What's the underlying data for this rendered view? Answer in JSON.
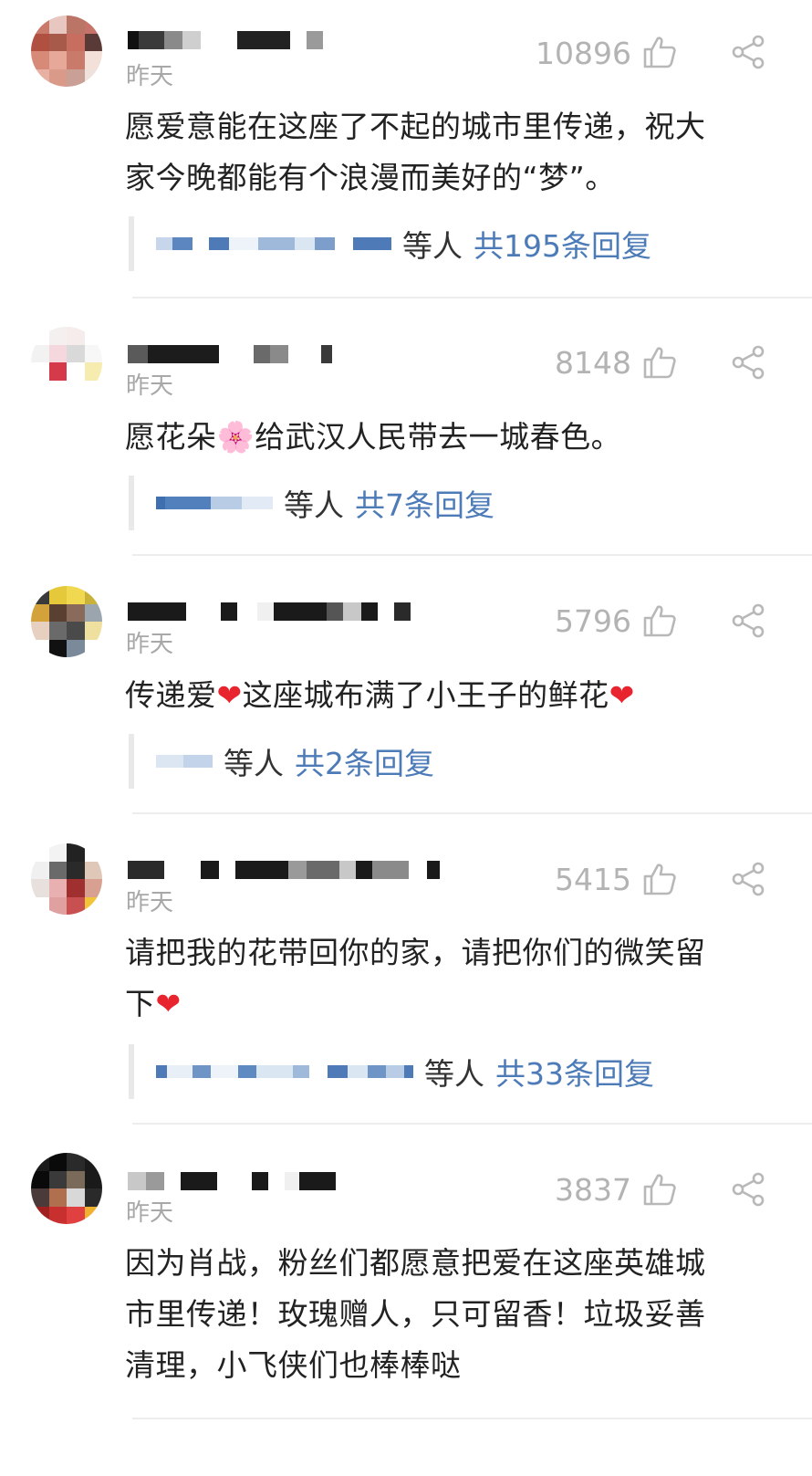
{
  "comments": [
    {
      "time": "昨天",
      "likes": "10896",
      "text_lines": [
        "愿爱意能在这座了不起的城市里传递，祝大",
        "家今晚都能有个浪漫而美好的“梦”。"
      ],
      "replies_etc": "等人",
      "replies_total": "共195条回复"
    },
    {
      "time": "昨天",
      "likes": "8148",
      "text_a": "愿花朵",
      "emoji": "🌸",
      "text_b": "给武汉人民带去一城春色。",
      "replies_etc": "等人",
      "replies_total": "共7条回复"
    },
    {
      "time": "昨天",
      "likes": "5796",
      "text_a": "传递爱",
      "emoji1": "❤",
      "text_b": "这座城布满了小王子的鲜花",
      "emoji2": "❤",
      "replies_etc": "等人",
      "replies_total": "共2条回复"
    },
    {
      "time": "昨天",
      "likes": "5415",
      "text_line1": "请把我的花带回你的家，请把你们的微笑留",
      "text_line2": "下",
      "emoji": "❤",
      "replies_etc": "等人",
      "replies_total": "共33条回复"
    },
    {
      "time": "昨天",
      "likes": "3837",
      "text_lines": [
        "因为肖战，粉丝们都愿意把爱在这座英雄城",
        "市里传递！玫瑰赠人，只可留香！垃圾妥善",
        "清理，小飞侠们也棒棒哒"
      ]
    }
  ],
  "icons": {
    "like": "thumbs-up-icon",
    "share": "share-icon"
  },
  "colors": {
    "link": "#4c7bb8",
    "meta": "#a8a8a8",
    "text": "#222222",
    "heart": "#e8242e"
  }
}
